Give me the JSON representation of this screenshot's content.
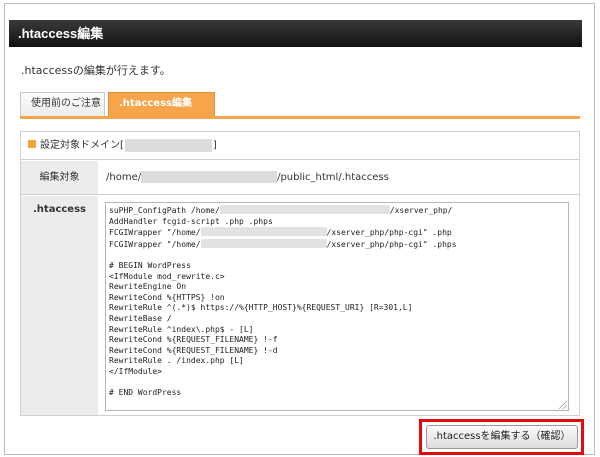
{
  "header": {
    "title": ".htaccess編集"
  },
  "description": ".htaccessの編集が行えます。",
  "tabs": [
    {
      "label": "使用前のご注意",
      "active": false
    },
    {
      "label": ".htaccess編集",
      "active": true
    }
  ],
  "section": {
    "heading_prefix": "設定対象ドメイン[",
    "heading_suffix": "]"
  },
  "target": {
    "label": "編集対象",
    "path_prefix": "/home/",
    "path_suffix": "/public_html/.htaccess"
  },
  "editor": {
    "label": ".htaccess",
    "lines": [
      {
        "before": "suPHP_ConfigPath /home/",
        "redact": true,
        "after": "/xserver_php/"
      },
      {
        "before": "AddHandler fcgid-script .php .phps",
        "redact": false,
        "after": ""
      },
      {
        "before": "FCGIWrapper \"/home/",
        "redact": true,
        "after": "/xserver_php/php-cgi\" .php"
      },
      {
        "before": "FCGIWrapper \"/home/",
        "redact": true,
        "after": "/xserver_php/php-cgi\" .phps"
      },
      {
        "before": "",
        "redact": false,
        "after": ""
      },
      {
        "before": "# BEGIN WordPress",
        "redact": false,
        "after": ""
      },
      {
        "before": "<IfModule mod_rewrite.c>",
        "redact": false,
        "after": ""
      },
      {
        "before": "RewriteEngine On",
        "redact": false,
        "after": ""
      },
      {
        "before": "RewriteCond %{HTTPS} !on",
        "redact": false,
        "after": ""
      },
      {
        "before": "RewriteRule ^(.*)$ https://%{HTTP_HOST}%{REQUEST_URI} [R=301,L]",
        "redact": false,
        "after": ""
      },
      {
        "before": "RewriteBase /",
        "redact": false,
        "after": ""
      },
      {
        "before": "RewriteRule ^index\\.php$ - [L]",
        "redact": false,
        "after": ""
      },
      {
        "before": "RewriteCond %{REQUEST_FILENAME} !-f",
        "redact": false,
        "after": ""
      },
      {
        "before": "RewriteCond %{REQUEST_FILENAME} !-d",
        "redact": false,
        "after": ""
      },
      {
        "before": "RewriteRule . /index.php [L]",
        "redact": false,
        "after": ""
      },
      {
        "before": "</IfModule>",
        "redact": false,
        "after": ""
      },
      {
        "before": "",
        "redact": false,
        "after": ""
      },
      {
        "before": "# END WordPress",
        "redact": false,
        "after": ""
      }
    ]
  },
  "actions": {
    "confirm_label": ".htaccessを編集する（確認）"
  },
  "colors": {
    "accent": "#f6a54a",
    "title_bg": "#1a1a1a",
    "highlight": "#e30b0b"
  }
}
